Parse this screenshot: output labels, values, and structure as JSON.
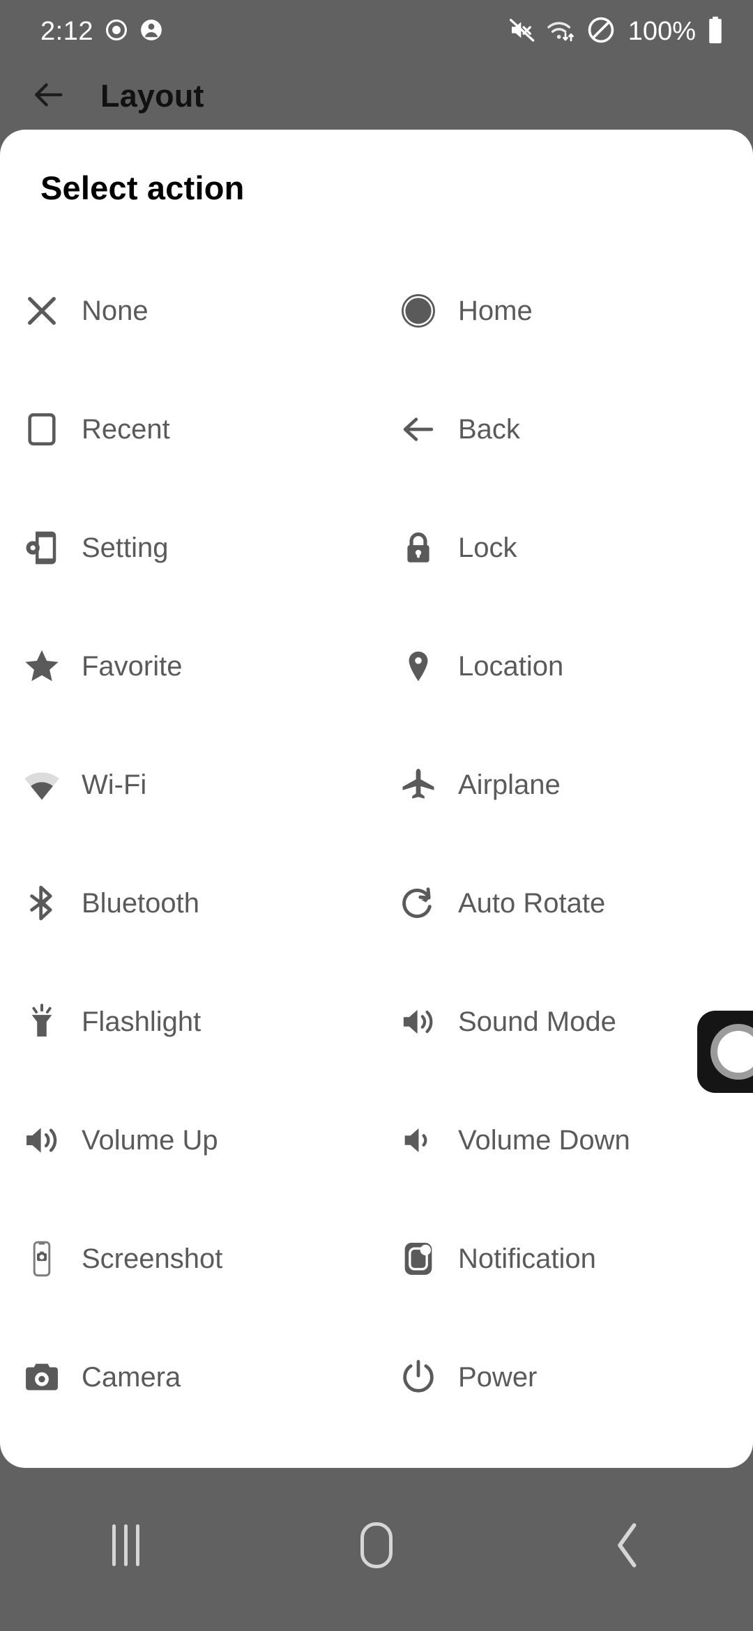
{
  "status_bar": {
    "time": "2:12",
    "left_icons": [
      "screen-record-icon",
      "account-icon"
    ],
    "right_icons": [
      "mute-icon",
      "wifi-data-icon",
      "do-not-disturb-icon"
    ],
    "battery_percent": "100%",
    "battery_icon": "battery-full-icon"
  },
  "toolbar": {
    "back_icon": "arrow-left-icon",
    "title": "Layout"
  },
  "dialog": {
    "title": "Select action",
    "actions": [
      {
        "label": "None",
        "icon": "close-icon"
      },
      {
        "label": "Home",
        "icon": "home-circle-icon"
      },
      {
        "label": "Recent",
        "icon": "recent-square-icon"
      },
      {
        "label": "Back",
        "icon": "arrow-left-icon"
      },
      {
        "label": "Setting",
        "icon": "phone-gear-icon"
      },
      {
        "label": "Lock",
        "icon": "lock-icon"
      },
      {
        "label": "Favorite",
        "icon": "star-icon"
      },
      {
        "label": "Location",
        "icon": "map-pin-icon"
      },
      {
        "label": "Wi-Fi",
        "icon": "wifi-icon"
      },
      {
        "label": "Airplane",
        "icon": "airplane-icon"
      },
      {
        "label": "Bluetooth",
        "icon": "bluetooth-icon"
      },
      {
        "label": "Auto Rotate",
        "icon": "auto-rotate-icon"
      },
      {
        "label": "Flashlight",
        "icon": "flashlight-icon"
      },
      {
        "label": "Sound Mode",
        "icon": "speaker-wave-icon"
      },
      {
        "label": "Volume Up",
        "icon": "volume-up-icon"
      },
      {
        "label": "Volume Down",
        "icon": "volume-down-icon"
      },
      {
        "label": "Screenshot",
        "icon": "phone-camera-icon"
      },
      {
        "label": "Notification",
        "icon": "notification-icon"
      },
      {
        "label": "Camera",
        "icon": "camera-icon"
      },
      {
        "label": "Power",
        "icon": "power-icon"
      }
    ]
  },
  "floating_button": {
    "icon": "assistive-touch-ring-icon"
  },
  "nav_bar": {
    "recents_icon": "recents-icon",
    "home_icon": "home-icon",
    "back_icon": "chevron-left-icon"
  },
  "colors": {
    "scrim": "#616161",
    "dialog_bg": "#ffffff",
    "icon_gray": "#5a5a5a",
    "label_gray": "#5a5a5a",
    "nav_glyph": "#d6d6d6"
  }
}
